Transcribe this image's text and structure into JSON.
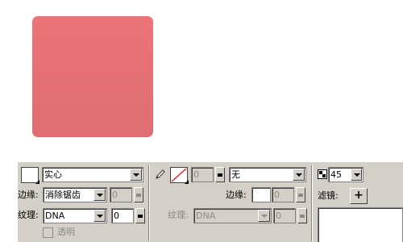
{
  "canvas": {
    "shape_colors": {
      "top": "#eb7476",
      "bottom": "#de6e72"
    }
  },
  "fill": {
    "type_value": "实心",
    "edge_label": "边缘:",
    "edge_value": "消除锯齿",
    "edge_amount": "0",
    "texture_label": "纹理:",
    "texture_value": "DNA",
    "texture_amount": "0",
    "transparent_label": "透明"
  },
  "stroke": {
    "size_value": "0",
    "type_value": "无",
    "edge_label": "边缘:",
    "edge_amount": "0",
    "texture_label": "纹理:",
    "texture_value": "DNA",
    "texture_amount": "0"
  },
  "effects": {
    "opacity_value": "45",
    "filters_label": "滤镜:",
    "add_label": "+"
  }
}
